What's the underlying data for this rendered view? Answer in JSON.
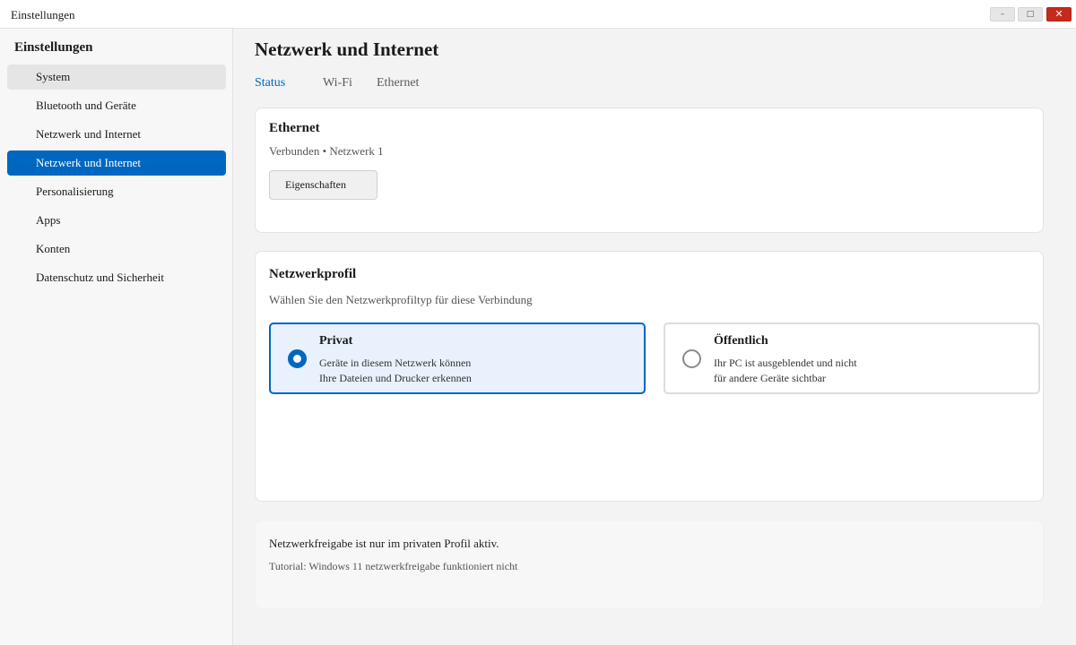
{
  "window": {
    "title": "Einstellungen",
    "minimize_label": "–",
    "maximize_label": "□",
    "close_label": "✕"
  },
  "sidebar": {
    "heading": "Einstellungen",
    "items": [
      {
        "label": "System",
        "state": "hover"
      },
      {
        "label": "Bluetooth und Geräte",
        "state": "normal"
      },
      {
        "label": "Netzwerk und Internet",
        "state": "normal"
      },
      {
        "label": "Netzwerk und Internet",
        "state": "selected"
      },
      {
        "label": "Personalisierung",
        "state": "normal"
      },
      {
        "label": "Apps",
        "state": "normal"
      },
      {
        "label": "Konten",
        "state": "normal"
      },
      {
        "label": "Datenschutz und Sicherheit",
        "state": "normal"
      }
    ]
  },
  "main": {
    "title": "Netzwerk und Internet",
    "tabs": [
      {
        "label": "Status",
        "active": true
      },
      {
        "label": "Wi-Fi",
        "active": false
      },
      {
        "label": "Ethernet",
        "active": false
      }
    ],
    "ethernet_card": {
      "title": "Ethernet",
      "status": "Verbunden • Netzwerk 1",
      "button_label": "Eigenschaften"
    },
    "profile_card": {
      "title": "Netzwerkprofil",
      "subtitle": "Wählen Sie den Netzwerkprofiltyp für diese Verbindung",
      "options": [
        {
          "title": "Privat",
          "line1": "Geräte in diesem Netzwerk können",
          "line2": "Ihre Dateien und Drucker erkennen",
          "selected": true
        },
        {
          "title": "Öffentlich",
          "line1": "Ihr PC ist ausgeblendet und nicht",
          "line2": "für andere Geräte sichtbar",
          "selected": false
        }
      ]
    },
    "info_card": {
      "text": "Netzwerkfreigabe ist nur im privaten Profil aktiv.",
      "link": "Tutorial: Windows 11 netzwerkfreigabe funktioniert nicht"
    }
  },
  "colors": {
    "accent": "#0067c0",
    "close_button": "#c42b1c",
    "selected_option_bg": "#e8f1fc"
  }
}
